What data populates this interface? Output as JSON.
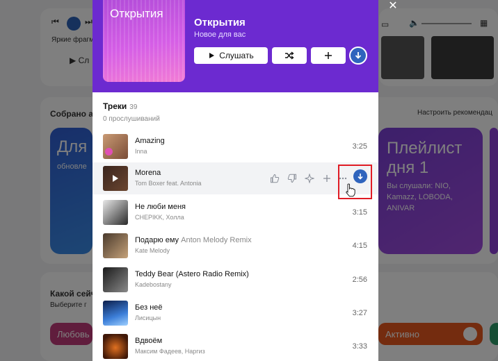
{
  "background": {
    "player_genre": "Яркие фрагм",
    "player_listen": "Сл",
    "collection_title": "Собрано ал",
    "recommend_link": "Настроить рекомендац",
    "card_left": {
      "title": "Для",
      "subtitle": "обновле"
    },
    "card_right": {
      "title_line1": "Плейлист",
      "title_line2": "дня 1",
      "subtitle": "Вы слушали: NIO, Kamazz, LOBODA, ANIVAR"
    },
    "mood_title": "Какой сейч",
    "mood_sub": "Выберите г",
    "pill_love": "Любовь",
    "pill_active": "Активно"
  },
  "playlist": {
    "cover_text": "Открытия",
    "title": "Открытия",
    "subtitle": "Новое для вас",
    "listen_label": "Слушать",
    "shuffle_icon": "shuffle-icon",
    "add_icon": "plus-icon",
    "download_icon": "download-icon"
  },
  "tracks_section": {
    "title": "Треки",
    "count": "39",
    "listens": "0 прослушиваний"
  },
  "tracks": [
    {
      "title": "Amazing",
      "suffix": "",
      "artist": "Inna",
      "duration": "3:25"
    },
    {
      "title": "Morena",
      "suffix": "",
      "artist": "Tom Boxer feat. Antonia",
      "duration": ""
    },
    {
      "title": "Не люби меня",
      "suffix": "",
      "artist": "CHEPIKK, Холла",
      "duration": "3:15"
    },
    {
      "title": "Подарю ему",
      "suffix": "Anton Melody Remix",
      "artist": "Kate Melody",
      "duration": "4:15"
    },
    {
      "title": "Teddy Bear (Astero Radio Remix)",
      "suffix": "",
      "artist": "Kadebostany",
      "duration": "2:56"
    },
    {
      "title": "Без неё",
      "suffix": "",
      "artist": "Лисицын",
      "duration": "3:27"
    },
    {
      "title": "Вдвоём",
      "suffix": "",
      "artist": "Максим Фадеев, Наргиз",
      "duration": "3:33"
    }
  ],
  "colors": {
    "header_purple": "#6c2ad0",
    "accent_blue": "#2f64bd",
    "highlight_red": "#e01b24"
  }
}
